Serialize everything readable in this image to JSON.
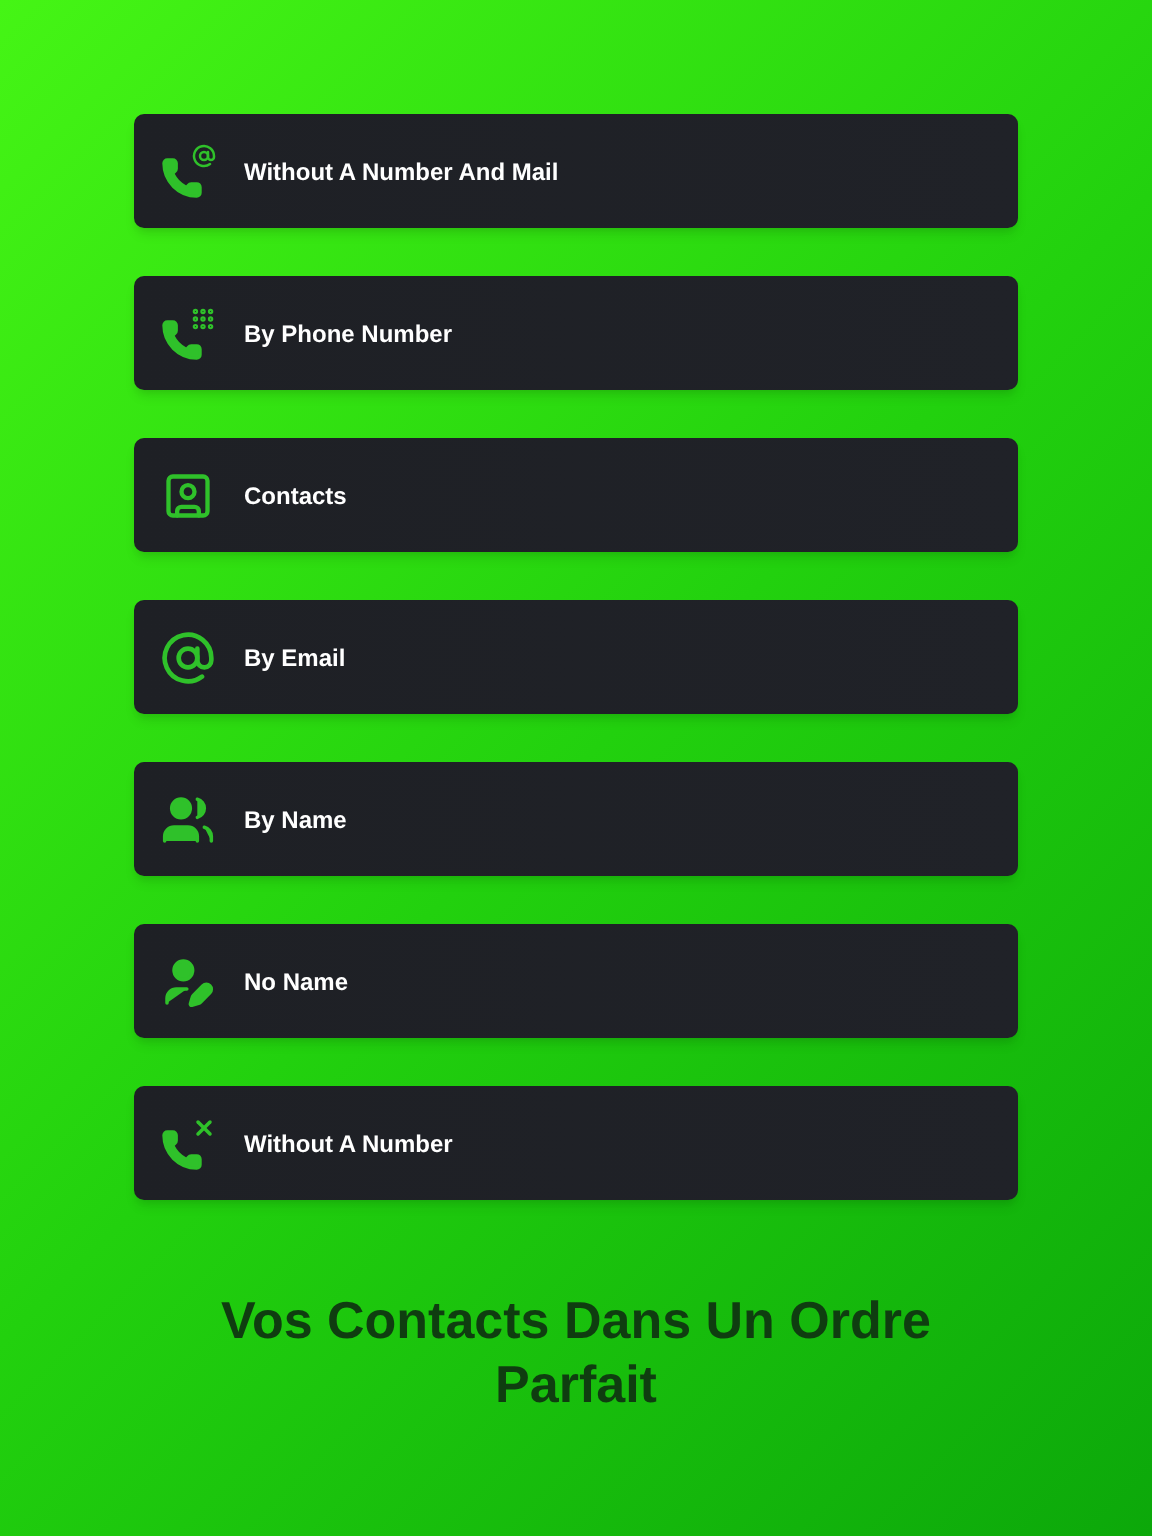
{
  "options": [
    {
      "kind": "phone-mail",
      "label": "Without A Number And Mail"
    },
    {
      "kind": "phone-keypad",
      "label": "By Phone Number"
    },
    {
      "kind": "contacts",
      "label": "Contacts"
    },
    {
      "kind": "email",
      "label": "By Email"
    },
    {
      "kind": "people",
      "label": "By Name"
    },
    {
      "kind": "person-edit",
      "label": "No Name"
    },
    {
      "kind": "phone-x",
      "label": "Without A Number"
    }
  ],
  "headline": "Vos Contacts Dans Un Ordre Parfait"
}
